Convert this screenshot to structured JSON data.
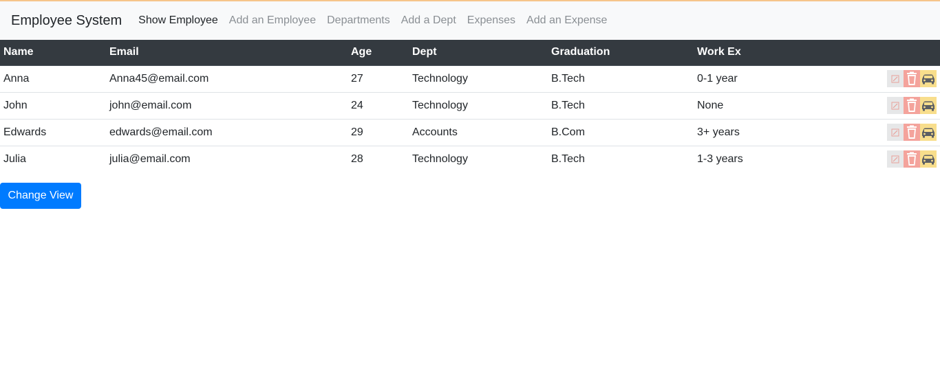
{
  "navbar": {
    "brand": "Employee System",
    "links": [
      {
        "label": "Show Employee",
        "active": true
      },
      {
        "label": "Add an Employee",
        "active": false
      },
      {
        "label": "Departments",
        "active": false
      },
      {
        "label": "Add a Dept",
        "active": false
      },
      {
        "label": "Expenses",
        "active": false
      },
      {
        "label": "Add an Expense",
        "active": false
      }
    ]
  },
  "table": {
    "headers": [
      "Name",
      "Email",
      "Age",
      "Dept",
      "Graduation",
      "Work Ex",
      ""
    ],
    "rows": [
      {
        "name": "Anna",
        "email": "Anna45@email.com",
        "age": "27",
        "dept": "Technology",
        "graduation": "B.Tech",
        "work_ex": "0-1 year"
      },
      {
        "name": "John",
        "email": "john@email.com",
        "age": "24",
        "dept": "Technology",
        "graduation": "B.Tech",
        "work_ex": "None"
      },
      {
        "name": "Edwards",
        "email": "edwards@email.com",
        "age": "29",
        "dept": "Accounts",
        "graduation": "B.Com",
        "work_ex": "3+ years"
      },
      {
        "name": "Julia",
        "email": "julia@email.com",
        "age": "28",
        "dept": "Technology",
        "graduation": "B.Tech",
        "work_ex": "1-3 years"
      }
    ],
    "row_actions": [
      {
        "icon": "edit-icon",
        "color": "#e6e7e8"
      },
      {
        "icon": "trash-icon",
        "color": "#f4a39c"
      },
      {
        "icon": "car-icon",
        "color": "#f8de8c"
      }
    ]
  },
  "change_view_label": "Change View",
  "colors": {
    "navbar_bg": "#f8f9fa",
    "table_header_bg": "#343a40",
    "primary": "#007bff",
    "top_accent": "#f6c58a"
  }
}
